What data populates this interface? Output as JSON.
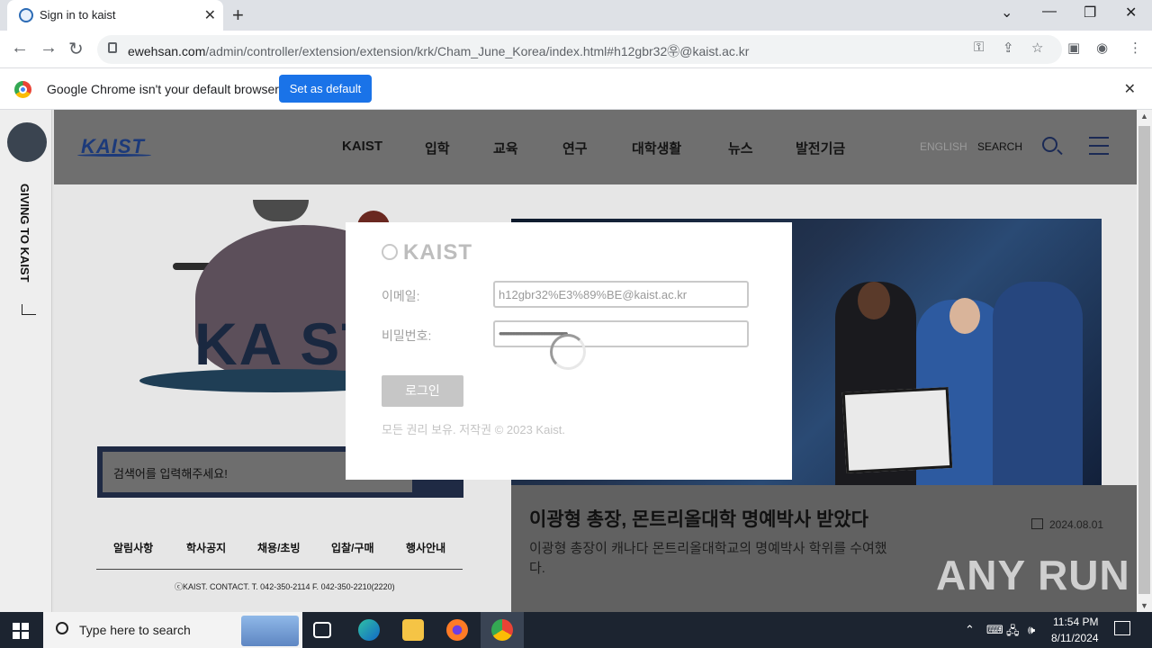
{
  "browser": {
    "tab_title": "Sign in to kaist",
    "url_host": "ewehsan.com",
    "url_path": "/admin/controller/extension/extension/krk/Cham_June_Korea/index.html#h12gbr32㉾@kaist.ac.kr",
    "infobar_message": "Google Chrome isn't your default browser",
    "infobar_button": "Set as default"
  },
  "site": {
    "logo": "KAIST",
    "menu": [
      "KAIST",
      "입학",
      "교육",
      "연구",
      "대학생활",
      "뉴스",
      "발전기금"
    ],
    "lang": "ENGLISH",
    "search_link": "SEARCH",
    "side_text": "GIVING TO  KAIST",
    "illustration_text": "KA ST",
    "search_placeholder": "검색어를 입력해주세요!",
    "footer_links": [
      "알림사항",
      "학사공지",
      "채용/초빙",
      "입찰/구매",
      "행사안내"
    ],
    "copyright": "ⓒKAIST. CONTACT. T. 042-350-2114 F. 042-350-2210(2220)"
  },
  "news": {
    "title": "이광형 총장, 몬트리올대학 명예박사 받았다",
    "date": "2024.08.01",
    "summary": "이광형 총장이 캐나다 몬트리올대학교의 명예박사 학위를 수여했다."
  },
  "login": {
    "logo": "KAIST",
    "email_label": "이메일:",
    "email_value": "h12gbr32%E3%89%BE@kaist.ac.kr",
    "password_label": "비밀번호:",
    "password_mask": "••••••••••••••••••••••••••••••••••••••••••••••••",
    "login_button": "로그인",
    "copyright": "모든 권리 보유. 저작권 © 2023 Kaist."
  },
  "watermark": "ANY RUN",
  "taskbar": {
    "search_placeholder": "Type here to search",
    "time": "11:54 PM",
    "date": "8/11/2024"
  }
}
